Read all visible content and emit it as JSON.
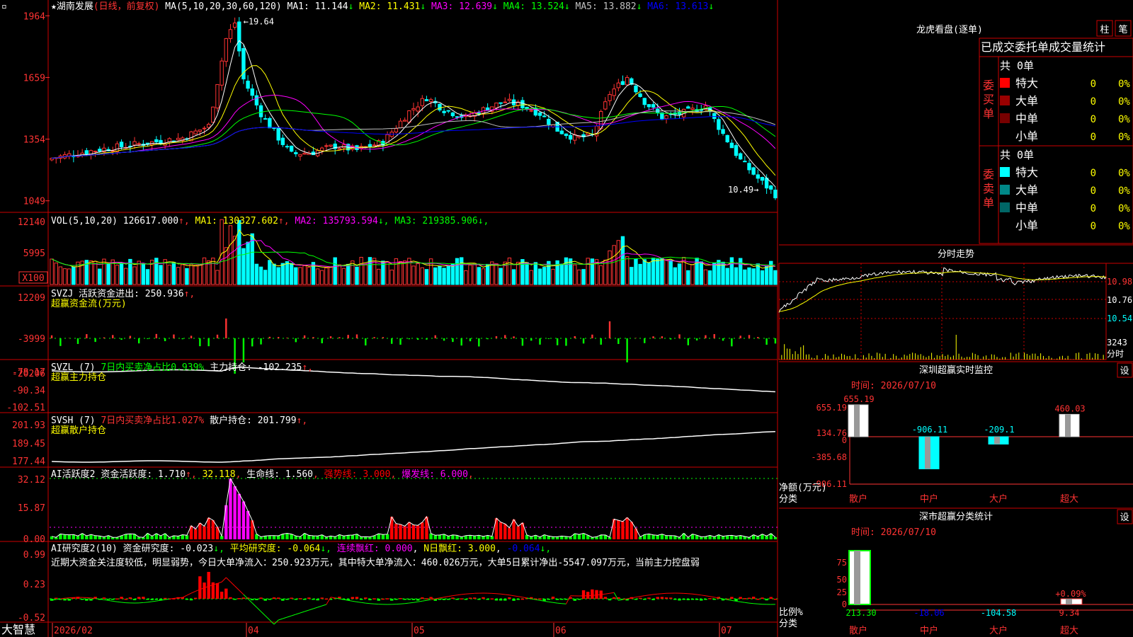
{
  "stock": {
    "name": "湖南发展",
    "mode": "(日线，前复权)",
    "ma_params": "MA(5,10,20,30,60,120)",
    "ma": [
      {
        "label": "MA1:",
        "value": "11.144",
        "arrow": "↓",
        "color": "#ffffff"
      },
      {
        "label": "MA2:",
        "value": "11.431",
        "arrow": "↓",
        "color": "#ffff00"
      },
      {
        "label": "MA3:",
        "value": "12.639",
        "arrow": "↓",
        "color": "#ff00ff"
      },
      {
        "label": "MA4:",
        "value": "13.524",
        "arrow": "↓",
        "color": "#00ff00"
      },
      {
        "label": "MA5:",
        "value": "13.882",
        "arrow": "↓",
        "color": "#c0c0c0"
      },
      {
        "label": "MA6:",
        "value": "13.613",
        "arrow": "↓",
        "color": "#0000ff"
      }
    ],
    "price_axis": [
      "1964",
      "1659",
      "1354",
      "1049"
    ],
    "high_label": "19.64",
    "low_label": "10.49"
  },
  "volume": {
    "params": "VOL(5,10,20)",
    "value": "126617.000",
    "ma": [
      {
        "label": "MA1:",
        "value": "130327.602",
        "arrow": "↑",
        "color": "#ffff00"
      },
      {
        "label": "MA2:",
        "value": "135793.594",
        "arrow": "↓",
        "color": "#ff00ff"
      },
      {
        "label": "MA3:",
        "value": "219385.906",
        "arrow": "↓",
        "color": "#00ff00"
      }
    ],
    "axis": [
      "12140",
      "5995"
    ],
    "unit_button": "X100"
  },
  "svzj": {
    "title": "SVZJ",
    "line1": "活跃资金进出: 250.936",
    "line1_arrow": "↑",
    "line2": "超赢资金流(万元)",
    "axis": [
      "12209",
      "-3999",
      "-20206"
    ]
  },
  "svzl": {
    "title": "SVZL (7)",
    "desc": "7日内买卖净占比0.939%",
    "label": "主力持仓: -102.235",
    "arrow": "↑",
    "line2": "超赢主力持仓",
    "axis": [
      "-78.17",
      "-90.34",
      "-102.51"
    ]
  },
  "svsh": {
    "title": "SVSH (7)",
    "desc": "7日内买卖净占比1.027%",
    "label": "散户持仓: 201.799",
    "arrow": "↑",
    "line2": "超赢散户持仓",
    "axis": [
      "201.93",
      "189.45",
      "177.44"
    ]
  },
  "ai_active": {
    "title": "AI活跃度2",
    "items": [
      {
        "text": "资金活跃度: 1.710",
        "arrow": "↑",
        "color": "#ffffff"
      },
      {
        "text": "32.118",
        "arrow": "",
        "color": "#ffff00"
      },
      {
        "text": "生命线: 1.560",
        "arrow": "",
        "color": "#ffffff"
      },
      {
        "text": "强势线: 3.000",
        "arrow": "",
        "color": "#ff0000"
      },
      {
        "text": "爆发线: 6.000",
        "arrow": "",
        "color": "#ff00ff"
      }
    ],
    "axis": [
      "32.12",
      "15.87",
      "0.00"
    ]
  },
  "ai_research": {
    "title": "AI研究度2(10)",
    "items": [
      {
        "text": "资金研究度: -0.023",
        "arrow": "↓",
        "color": "#ffffff"
      },
      {
        "text": "平均研究度: -0.064",
        "arrow": "↓",
        "color": "#ffff00"
      },
      {
        "text": "连续飘红: 0.000",
        "arrow": "",
        "color": "#ff00ff"
      },
      {
        "text": "N日飘红: 3.000",
        "arrow": "",
        "color": "#ffff00"
      },
      {
        "text": "-0.064",
        "arrow": "↓",
        "color": "#0000ff"
      }
    ],
    "summary": "近期大资金关注度较低，明显弱势，今日大单净流入：250.923万元，其中特大单净流入：460.026万元，大单5日累计净出-5547.097万元，当前主力控盘弱",
    "axis": [
      "0.99",
      "0.23",
      "-0.52"
    ]
  },
  "date_axis": {
    "brand": "大智慧",
    "labels": [
      "2026/02",
      "04",
      "05",
      "06",
      "07"
    ]
  },
  "dragon_panel": {
    "title": "龙虎看盘(逐单)",
    "btn1": "柱",
    "btn2": "笔",
    "header": "已成交委托单成交量统计",
    "buy": {
      "side": "委买单",
      "total": "共 0单",
      "rows": [
        {
          "label": "特大",
          "count": "0",
          "pct": "0%",
          "color": "#ff0000"
        },
        {
          "label": "大单",
          "count": "0",
          "pct": "0%",
          "color": "#990000"
        },
        {
          "label": "中单",
          "count": "0",
          "pct": "0%",
          "color": "#770000"
        },
        {
          "label": "小单",
          "count": "0",
          "pct": "0%",
          "color": ""
        }
      ]
    },
    "sell": {
      "side": "委卖单",
      "total": "共 0单",
      "rows": [
        {
          "label": "特大",
          "count": "0",
          "pct": "0%",
          "color": "#00ffff"
        },
        {
          "label": "大单",
          "count": "0",
          "pct": "0%",
          "color": "#008888"
        },
        {
          "label": "中单",
          "count": "0",
          "pct": "0%",
          "color": "#006666"
        },
        {
          "label": "小单",
          "count": "0",
          "pct": "0%",
          "color": ""
        }
      ]
    }
  },
  "intraday": {
    "title": "分时走势",
    "axis": [
      "10.98",
      "10.76",
      "10.54"
    ],
    "vol_label": "3243",
    "mode_label": "分时"
  },
  "sz_monitor": {
    "title": "深圳超赢实时监控",
    "settings_btn": "设",
    "time_label": "时间: 2026/07/10",
    "axis": [
      "655.19",
      "134.76",
      "0",
      "-385.68",
      "-906.11"
    ],
    "bar_labels": [
      "655.19",
      "-906.11",
      "-209.1",
      "460.03"
    ],
    "y_caption": "净额(万元)",
    "x_caption": "分类",
    "categories": [
      "散户",
      "中户",
      "大户",
      "超大"
    ]
  },
  "sz_class": {
    "title": "深市超赢分类统计",
    "settings_btn": "设",
    "time_label": "时间: 2026/07/10",
    "axis": [
      "75",
      "50",
      "25",
      "0"
    ],
    "bar_labels": [
      "213.30",
      "-18.06",
      "-104.58",
      "+0.09%",
      "9.34"
    ],
    "y_caption": "比例%",
    "x_caption": "分类",
    "categories": [
      "散户",
      "中户",
      "大户",
      "超大"
    ]
  },
  "colors": {
    "up": "#ff3333",
    "down": "#00ffff",
    "border": "#cc0000",
    "text_red": "#ff3333"
  },
  "chart_data": [
    {
      "type": "candlestick",
      "title": "湖南发展",
      "ylim": [
        10.49,
        19.64
      ],
      "categories": [
        "2026/02",
        "04",
        "05",
        "06",
        "07"
      ],
      "series": [
        {
          "name": "MA1",
          "values": [
            11.144
          ]
        },
        {
          "name": "MA2",
          "values": [
            11.431
          ]
        },
        {
          "name": "MA3",
          "values": [
            12.639
          ]
        },
        {
          "name": "MA4",
          "values": [
            13.524
          ]
        },
        {
          "name": "MA5",
          "values": [
            13.882
          ]
        },
        {
          "name": "MA6",
          "values": [
            13.613
          ]
        }
      ]
    },
    {
      "type": "bar",
      "categories": [
        "散户",
        "中户",
        "大户",
        "超大"
      ],
      "values": [
        655.19,
        -906.11,
        -209.1,
        460.03
      ],
      "ylabel": "净额(万元)",
      "xlabel": "分类"
    },
    {
      "type": "bar",
      "categories": [
        "散户",
        "中户",
        "大户",
        "超大"
      ],
      "values": [
        213.3,
        -18.06,
        -104.58,
        9.34
      ],
      "ylabel": "比例%",
      "xlabel": "分类"
    }
  ]
}
